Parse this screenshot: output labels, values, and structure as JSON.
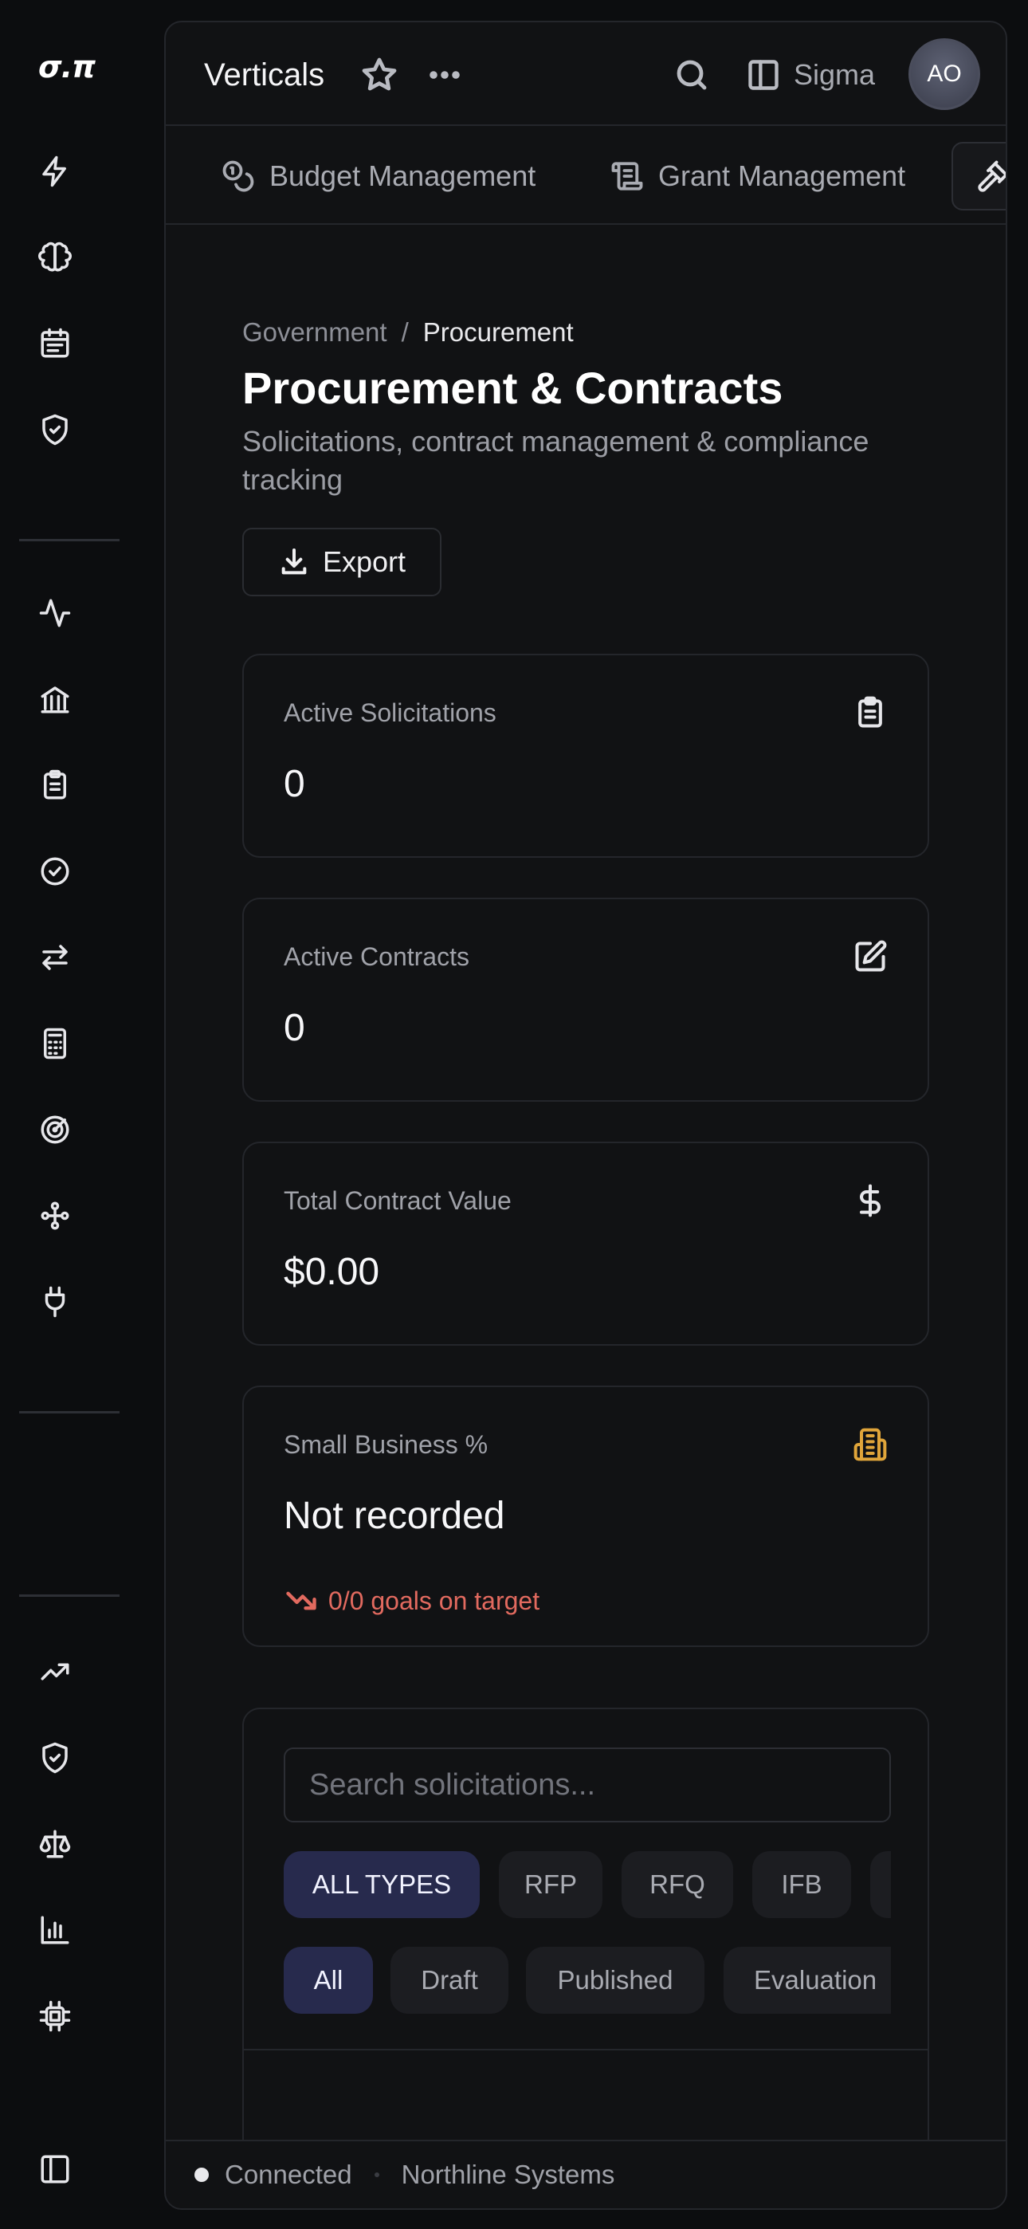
{
  "app": {
    "logo": "σ.π"
  },
  "header": {
    "title": "Verticals",
    "sidebar_label": "Sigma",
    "avatar_initials": "AO"
  },
  "tabs": [
    {
      "label": "Budget Management",
      "icon": "coins-icon"
    },
    {
      "label": "Grant Management",
      "icon": "scroll-icon"
    },
    {
      "label": "",
      "icon": "gavel-icon",
      "active": true
    }
  ],
  "breadcrumb": {
    "parent": "Government",
    "separator": "/",
    "current": "Procurement"
  },
  "page": {
    "title": "Procurement & Contracts",
    "subtitle": "Solicitations, contract management & compliance tracking",
    "export_label": "Export"
  },
  "stats": [
    {
      "label": "Active Solicitations",
      "value": "0",
      "icon": "clipboard-icon"
    },
    {
      "label": "Active Contracts",
      "value": "0",
      "icon": "edit-icon"
    },
    {
      "label": "Total Contract Value",
      "value": "$0.00",
      "icon": "dollar-icon"
    },
    {
      "label": "Small Business %",
      "value": "Not recorded",
      "icon": "building-icon",
      "icon_color": "#e0a53a",
      "trend": "0/0 goals on target",
      "trend_color": "#e26a5f"
    }
  ],
  "filters": {
    "search_placeholder": "Search solicitations...",
    "types": [
      "ALL TYPES",
      "RFP",
      "RFQ",
      "IFB",
      ""
    ],
    "statuses": [
      "All",
      "Draft",
      "Published",
      "Evaluation"
    ]
  },
  "status_bar": {
    "connection": "Connected",
    "org": "Northline Systems"
  },
  "colors": {
    "accent_chip": "#272a4d",
    "background": "#0c0d0f",
    "panel": "#111214"
  }
}
